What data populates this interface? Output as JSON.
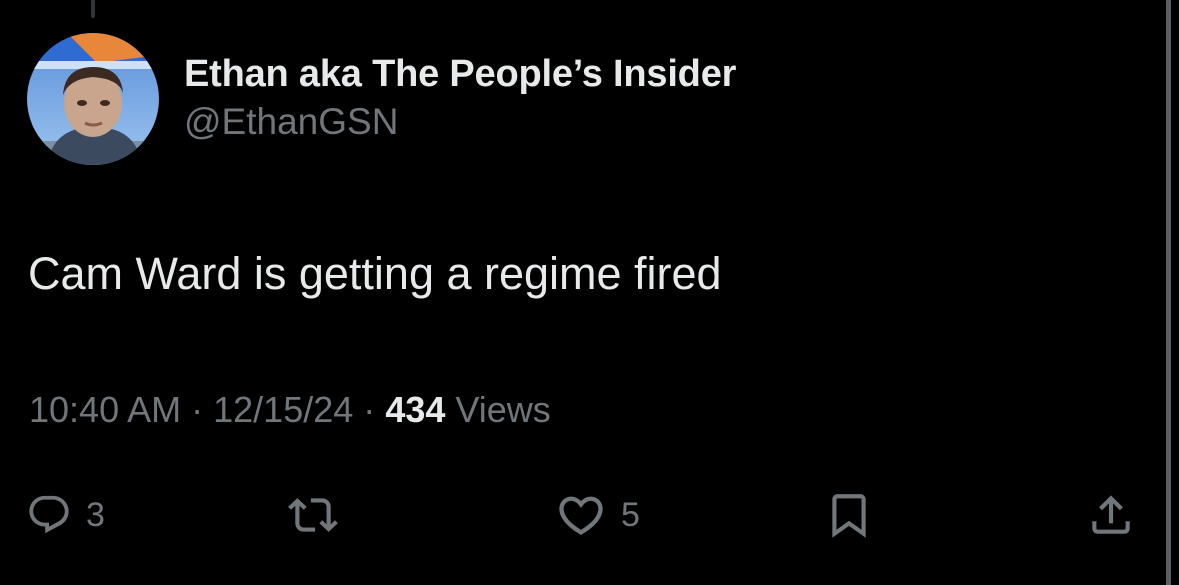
{
  "author": {
    "display_name": "Ethan aka The People’s Insider",
    "handle": "@EthanGSN",
    "avatar_icon": "profile-photo"
  },
  "tweet": {
    "text": "Cam Ward is getting a regime fired"
  },
  "meta": {
    "time": "10:40 AM",
    "separator": "·",
    "date": "12/15/24",
    "views_count": "434",
    "views_label": "Views"
  },
  "actions": {
    "reply": {
      "icon": "reply-icon",
      "count": "3"
    },
    "retweet": {
      "icon": "retweet-icon"
    },
    "like": {
      "icon": "heart-icon",
      "count": "5"
    },
    "bookmark": {
      "icon": "bookmark-icon"
    },
    "share": {
      "icon": "share-icon"
    }
  },
  "colors": {
    "background": "#000000",
    "primary_text": "#e7e9ea",
    "secondary_text": "#71767b"
  }
}
